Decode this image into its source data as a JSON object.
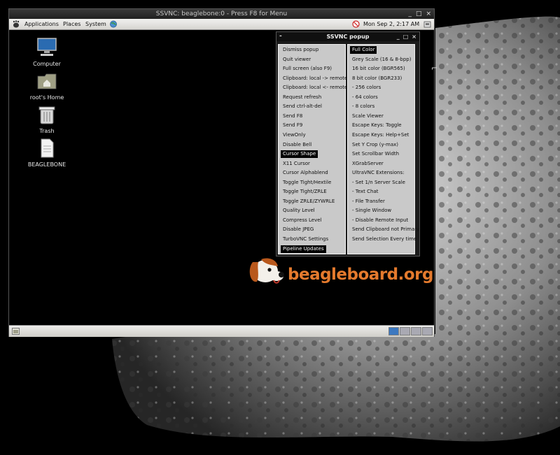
{
  "window": {
    "title": "SSVNC: beaglebone:0 - Press F8 for Menu",
    "controls": [
      "_",
      "□",
      "×"
    ]
  },
  "panel": {
    "menus": [
      "Applications",
      "Places",
      "System"
    ],
    "clock": "Mon Sep  2,  2:17 AM"
  },
  "desktop_icons": [
    {
      "label": "Computer",
      "icon": "computer-icon"
    },
    {
      "label": "root's Home",
      "icon": "home-folder-icon"
    },
    {
      "label": "Trash",
      "icon": "trash-icon"
    },
    {
      "label": "BEAGLEBONE",
      "icon": "document-icon"
    }
  ],
  "popup": {
    "title": "SSVNC popup",
    "dash": "-",
    "controls": [
      "_",
      "□",
      "×"
    ],
    "left_items": [
      "Dismiss popup",
      "Quit viewer",
      "Full screen  (also F9)",
      "Clipboard: local -> remote",
      "Clipboard: local <- remote",
      "Request refresh",
      "Send ctrl-alt-del",
      "Send F8",
      "Send F9",
      "ViewOnly",
      "Disable Bell",
      "Cursor Shape",
      "X11 Cursor",
      "Cursor Alphablend",
      "Toggle Tight/Hextile",
      "Toggle Tight/ZRLE",
      "Toggle ZRLE/ZYWRLE",
      "Quality Level",
      "Compress Level",
      "Disable JPEG",
      "TurboVNC Settings",
      "Pipeline Updates"
    ],
    "right_items": [
      "Full Color",
      "Grey Scale (16 & 8-bpp)",
      "16 bit color (BGR565)",
      "8   bit color (BGR233)",
      "-      256 colors",
      "-        64 colors",
      "-          8 colors",
      "Scale Viewer",
      "Escape Keys: Toggle",
      "Escape Keys: Help+Set",
      "Set Y Crop (y-max)",
      "Set Scrollbar Width",
      "XGrabServer",
      "UltraVNC Extensions:",
      "- Set 1/n Server Scale",
      "- Text Chat",
      "- File Transfer",
      "- Single Window",
      "- Disable Remote Input",
      "Send Clipboard not Primary",
      "Send Selection Every time"
    ],
    "selected_left": [
      "Cursor Shape",
      "Pipeline Updates"
    ],
    "selected_right": [
      "Full Color"
    ]
  },
  "logo": {
    "text": "beagleboard.org",
    "color": "#e47a2d"
  }
}
